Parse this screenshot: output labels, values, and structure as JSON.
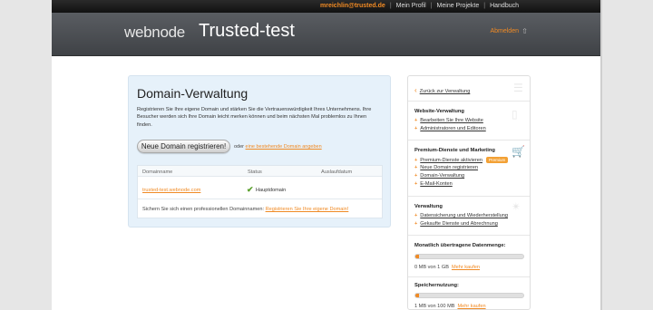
{
  "topbar": {
    "email": "mreichlin@trusted.de",
    "links": [
      "Mein Profil",
      "Meine Projekte",
      "Handbuch"
    ]
  },
  "header": {
    "logo": "webnode",
    "site_title": "Trusted-test",
    "admin_link": "Abmelden"
  },
  "main": {
    "title": "Domain-Verwaltung",
    "description": "Registrieren Sie Ihre eigene Domain und stärken Sie die Vertrauenswürdigkeit Ihres Unternehmens. Ihre Besucher werden sich Ihre Domain leicht merken können und beim nächsten Mal problemlos zu Ihnen finden.",
    "register_button": "Neue Domain registrieren!",
    "alt_prefix": "oder",
    "alt_link": "eine bestehende Domain angeben",
    "table": {
      "headers": [
        "Domainname",
        "Status",
        "Auslaufdatum"
      ],
      "rows": [
        {
          "domain": "trusted-test.webnode.com",
          "status": "Hauptdomain",
          "expires": ""
        }
      ],
      "footer_text": "Sichern Sie sich einen professionellen Domainnamen:",
      "footer_link": "Registrieren Sie Ihre eigene Domain!"
    }
  },
  "sidebar": {
    "back": "Zurück zur Verwaltung",
    "sections": [
      {
        "title": "Website-Verwaltung",
        "items": [
          "Bearbeiten Sie Ihre Website",
          "Administratoren und Editoren"
        ]
      },
      {
        "title": "Premium-Dienste und Marketing",
        "items": [
          "Premium-Dienste aktivieren",
          "Neue Domain registrieren",
          "Domain-Verwaltung",
          "E-Mail-Konten"
        ],
        "badge": "Premium"
      },
      {
        "title": "Verwaltung",
        "items": [
          "Datensicherung und Wiederherstellung",
          "Gekaufte Dienste und Abrechnung"
        ]
      }
    ],
    "traffic": {
      "title": "Monatlich übertragene Datenmenge:",
      "usage": "0 MB von 1 GB",
      "link": "Mehr kaufen",
      "fraction": 0.03
    },
    "storage": {
      "title": "Speichernutzung:",
      "usage": "1 MB von 100 MB",
      "link": "Mehr kaufen",
      "fraction": 0.03
    }
  },
  "colors": {
    "accent": "#f08a24",
    "header_bg": "#4a4d51",
    "panel_bg": "#e6f1fa",
    "check": "#5aa02c"
  }
}
